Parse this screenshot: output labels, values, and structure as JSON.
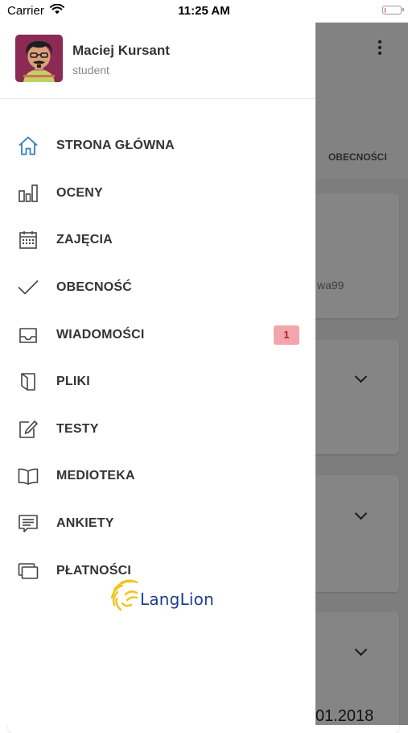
{
  "status_bar": {
    "carrier": "Carrier",
    "time": "11:25 AM",
    "battery_level": 0.1,
    "battery_color": "#e0312b"
  },
  "background": {
    "tab_label": "OBECNOŚCI",
    "card_text": "wa99",
    "date_text": "01.2018"
  },
  "drawer": {
    "user": {
      "name": "Maciej Kursant",
      "role": "student"
    },
    "accent_color": "#2f80c2",
    "menu": [
      {
        "label": "STRONA GŁÓWNA",
        "icon": "home-icon",
        "active": true
      },
      {
        "label": "OCENY",
        "icon": "bar-chart-icon"
      },
      {
        "label": "ZAJĘCIA",
        "icon": "calendar-icon"
      },
      {
        "label": "OBECNOŚĆ",
        "icon": "checkmark-icon"
      },
      {
        "label": "WIADOMOŚCI",
        "icon": "inbox-icon",
        "badge": "1",
        "badge_bg": "#f2a6ab",
        "badge_color": "#b0202e"
      },
      {
        "label": "PLIKI",
        "icon": "file-icon"
      },
      {
        "label": "TESTY",
        "icon": "edit-icon"
      },
      {
        "label": "MEDIOTEKA",
        "icon": "book-icon"
      },
      {
        "label": "ANKIETY",
        "icon": "message-icon"
      },
      {
        "label": "PŁATNOŚCI",
        "icon": "cards-icon"
      }
    ],
    "logo_text": "LangLion"
  }
}
